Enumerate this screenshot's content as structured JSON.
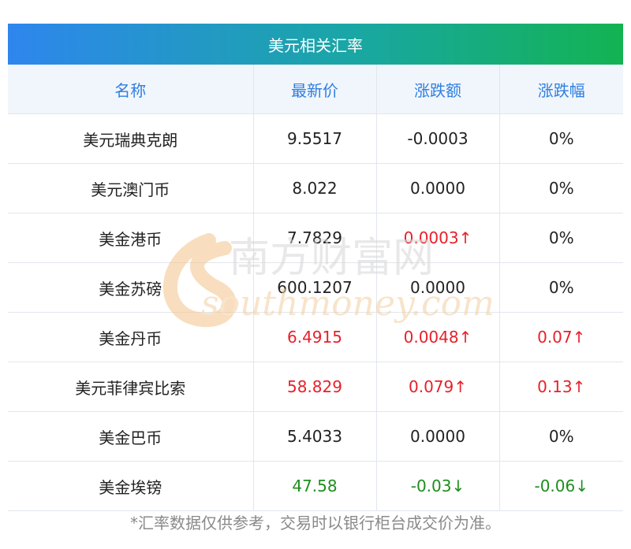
{
  "title": "美元相关汇率",
  "columns": [
    "名称",
    "最新价",
    "涨跌额",
    "涨跌幅"
  ],
  "rows": [
    {
      "name": "美元瑞典克朗",
      "price": "9.5517",
      "change": "-0.0003",
      "pct": "0%",
      "price_dir": "flat",
      "change_dir": "flat",
      "pct_dir": "flat"
    },
    {
      "name": "美元澳门币",
      "price": "8.022",
      "change": "0.0000",
      "pct": "0%",
      "price_dir": "flat",
      "change_dir": "flat",
      "pct_dir": "flat"
    },
    {
      "name": "美金港币",
      "price": "7.7829",
      "change": "0.0003↑",
      "pct": "0%",
      "price_dir": "flat",
      "change_dir": "up",
      "pct_dir": "flat"
    },
    {
      "name": "美金苏磅",
      "price": "600.1207",
      "change": "0.0000",
      "pct": "0%",
      "price_dir": "flat",
      "change_dir": "flat",
      "pct_dir": "flat"
    },
    {
      "name": "美金丹币",
      "price": "6.4915",
      "change": "0.0048↑",
      "pct": "0.07↑",
      "price_dir": "up",
      "change_dir": "up",
      "pct_dir": "up"
    },
    {
      "name": "美元菲律宾比索",
      "price": "58.829",
      "change": "0.079↑",
      "pct": "0.13↑",
      "price_dir": "up",
      "change_dir": "up",
      "pct_dir": "up"
    },
    {
      "name": "美金巴币",
      "price": "5.4033",
      "change": "0.0000",
      "pct": "0%",
      "price_dir": "flat",
      "change_dir": "flat",
      "pct_dir": "flat"
    },
    {
      "name": "美金埃镑",
      "price": "47.58",
      "change": "-0.03↓",
      "pct": "-0.06↓",
      "price_dir": "down",
      "change_dir": "down",
      "pct_dir": "down"
    }
  ],
  "footnote": "*汇率数据仅供参考，交易时以银行柜台成交价为准。",
  "watermark": {
    "cn": "南方财富网",
    "en": "southmoney.com"
  },
  "colors": {
    "up": "#e8202a",
    "down": "#1e8e1e",
    "header_text": "#2f7fe0",
    "gradient_start": "#2e86ee",
    "gradient_end": "#13b352"
  }
}
